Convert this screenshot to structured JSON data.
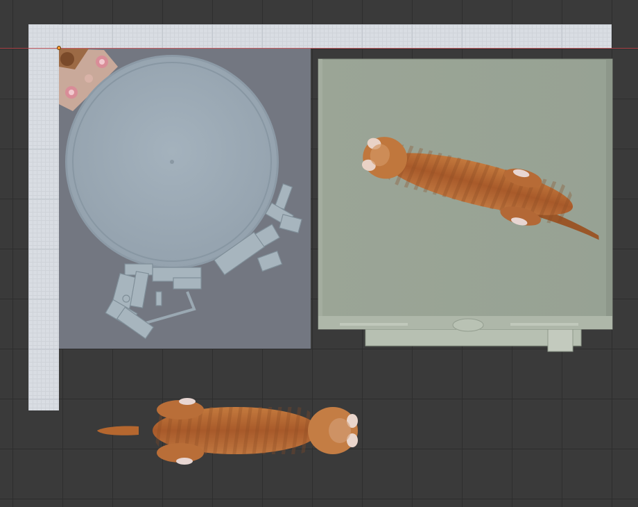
{
  "viewport": {
    "background": "#3a3a3a",
    "grid_color": "#2e2e2e",
    "ruler_color": "#d9dde3",
    "axis_line_color": "#c0444a",
    "origin_marker_color": "#ff9a2e"
  },
  "objects": [
    {
      "name": "round-table-object",
      "color": "#9caab5"
    },
    {
      "name": "robot-arm-object",
      "color": "#a9b7c0"
    },
    {
      "name": "pink-flower-decal-object",
      "color": "#d99aa0"
    },
    {
      "name": "cabinet-object",
      "color": "#9aa597"
    },
    {
      "name": "lying-cat-object-upper",
      "color": "#b3652f"
    },
    {
      "name": "lying-cat-object-lower",
      "color": "#b3652f"
    }
  ]
}
